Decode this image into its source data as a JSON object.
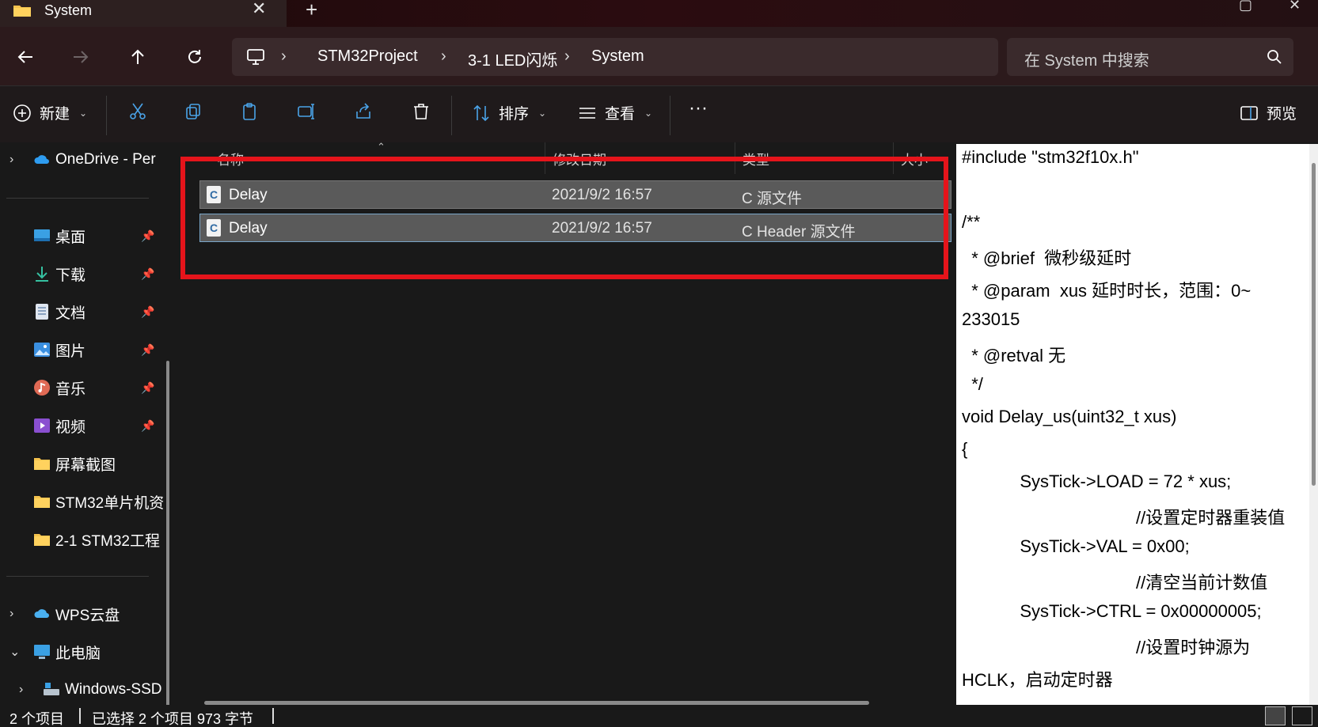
{
  "window": {
    "tab_title": "System",
    "close_glyph": "✕",
    "newtab_glyph": "+"
  },
  "nav": {
    "breadcrumb": [
      "STM32Project",
      "3-1 LED闪烁",
      "System"
    ],
    "search_placeholder": "在 System 中搜索"
  },
  "toolbar": {
    "new_label": "新建",
    "sort_label": "排序",
    "view_label": "查看",
    "more_label": "···",
    "preview_label": "预览"
  },
  "sidebar": {
    "onedrive": "OneDrive - Per",
    "quick": [
      {
        "label": "桌面",
        "icon": "desktop-icon",
        "pinned": true
      },
      {
        "label": "下载",
        "icon": "download-icon",
        "pinned": true
      },
      {
        "label": "文档",
        "icon": "document-icon",
        "pinned": true
      },
      {
        "label": "图片",
        "icon": "pictures-icon",
        "pinned": true
      },
      {
        "label": "音乐",
        "icon": "music-icon",
        "pinned": true
      },
      {
        "label": "视频",
        "icon": "video-icon",
        "pinned": true
      },
      {
        "label": "屏幕截图",
        "icon": "folder-icon",
        "pinned": false
      },
      {
        "label": "STM32单片机资",
        "icon": "folder-icon",
        "pinned": false
      },
      {
        "label": "2-1 STM32工程",
        "icon": "folder-icon",
        "pinned": false
      }
    ],
    "wps": "WPS云盘",
    "thispc": "此电脑",
    "drive": "Windows-SSD"
  },
  "filelist": {
    "columns": [
      "名称",
      "修改日期",
      "类型",
      "大小"
    ],
    "rows": [
      {
        "name": "Delay",
        "date": "2021/9/2 16:57",
        "type": "C 源文件"
      },
      {
        "name": "Delay",
        "date": "2021/9/2 16:57",
        "type": "C Header 源文件"
      }
    ]
  },
  "preview": {
    "lines": [
      "#include \"stm32f10x.h\"",
      "",
      "/**",
      "  * @brief  微秒级延时",
      "  * @param  xus 延时时长，范围：0~",
      "233015",
      "  * @retval 无",
      "  */",
      "void Delay_us(uint32_t xus)",
      "{",
      "            SysTick->LOAD = 72 * xus;",
      "                                    //设置定时器重装值",
      "            SysTick->VAL = 0x00;",
      "                                    //清空当前计数值",
      "            SysTick->CTRL = 0x00000005;",
      "                                    //设置时钟源为",
      "HCLK，启动定时器"
    ]
  },
  "status": {
    "count": "2 个项目",
    "selected": "已选择 2 个项目  973 字节"
  },
  "colors": {
    "highlight": "#e5141b",
    "accent": "#4aa3e8"
  }
}
